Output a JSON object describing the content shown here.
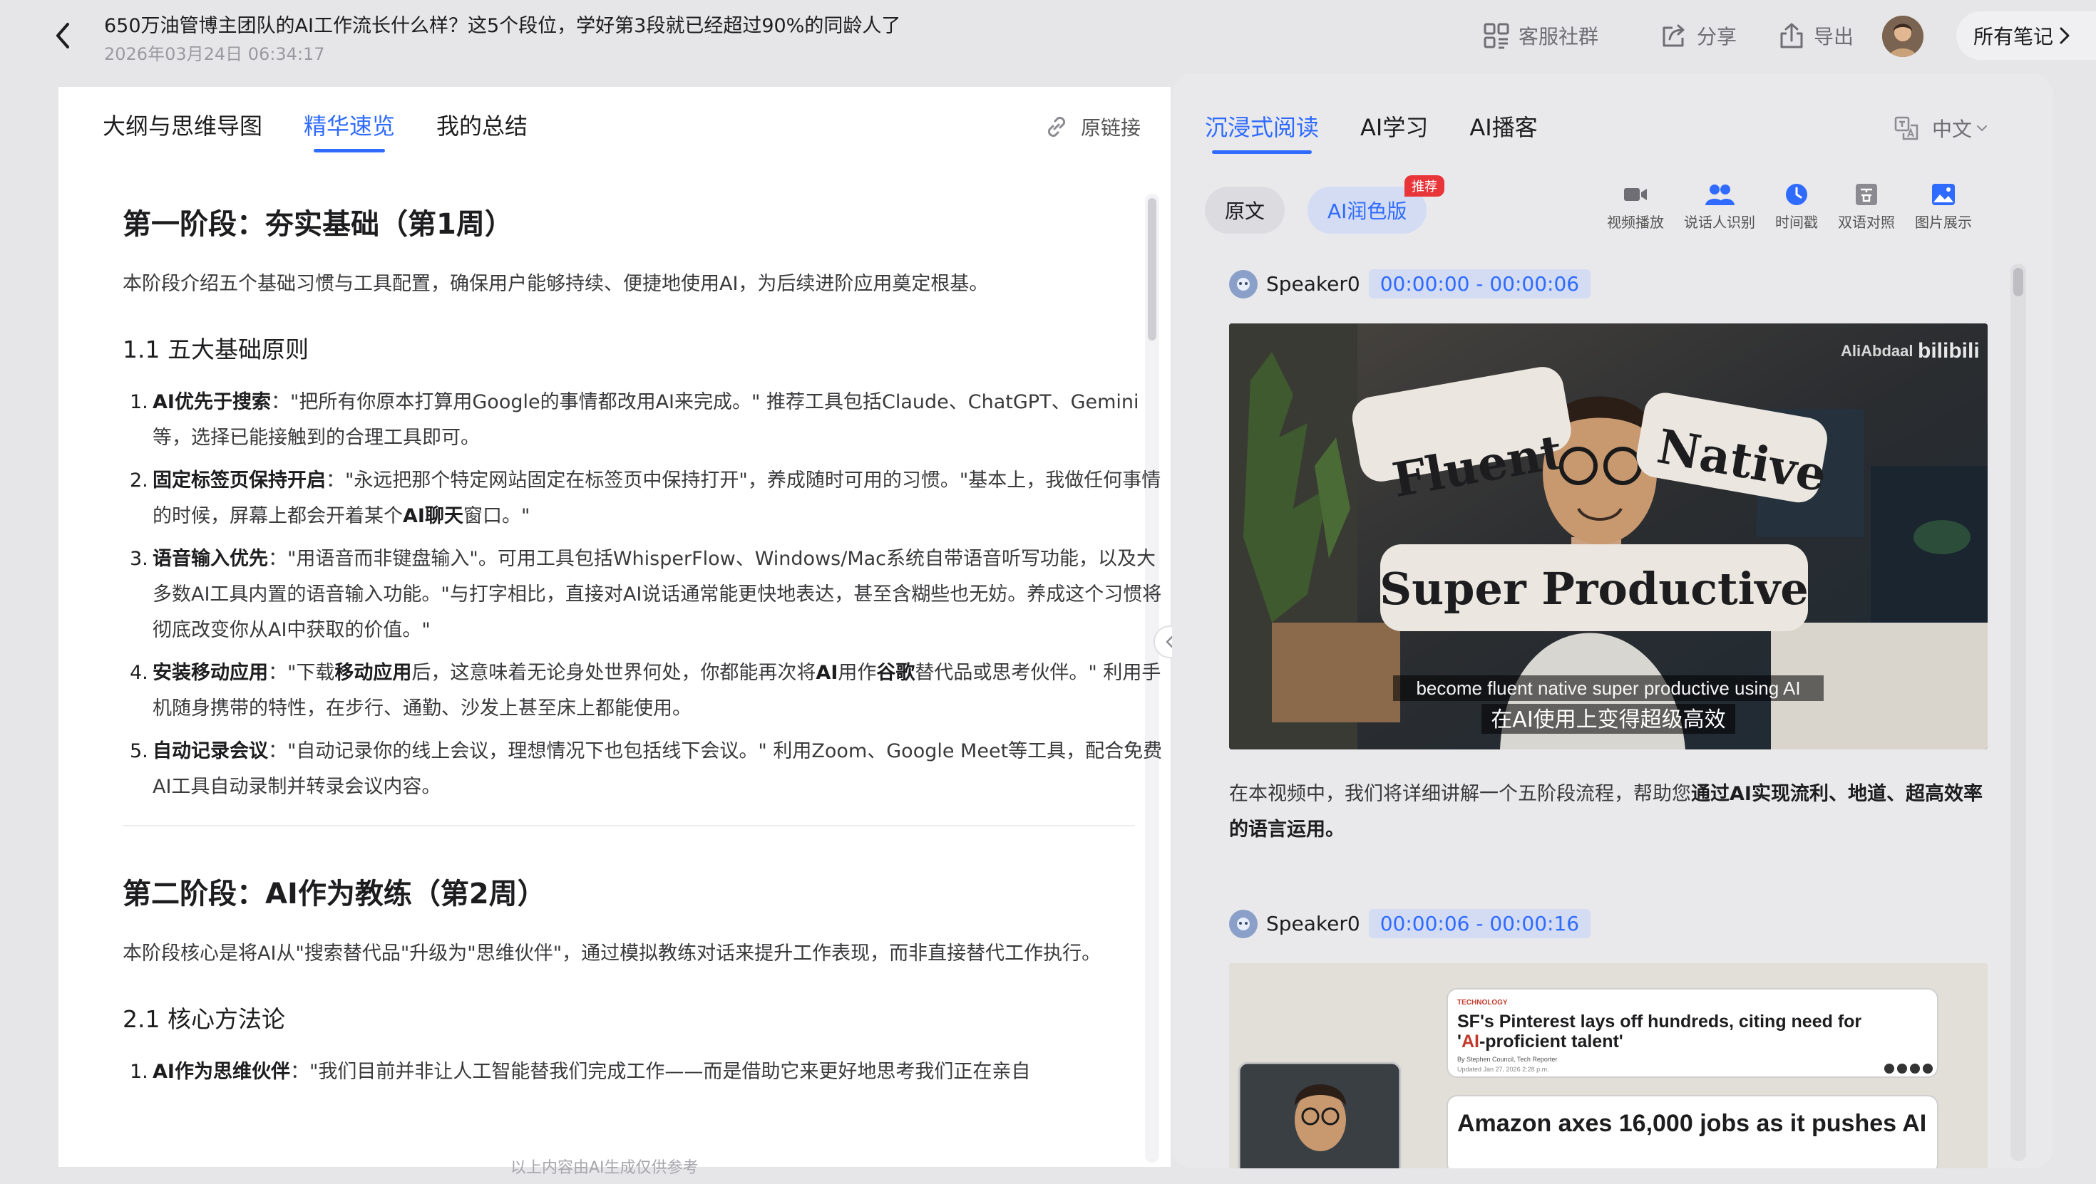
{
  "header": {
    "title": "650万油管博主团队的AI工作流长什么样？这5个段位，学好第3段就已经超过90%的同龄人了",
    "date": "2026年03月24日 06:34:17",
    "actions": {
      "community": "客服社群",
      "share": "分享",
      "export": "导出"
    },
    "all_notes": "所有笔记"
  },
  "left": {
    "tabs": [
      "大纲与思维导图",
      "精华速览",
      "我的总结"
    ],
    "active_tab": 1,
    "original_link": "原链接",
    "footnote": "以上内容由AI生成仅供参考",
    "stage1": {
      "title": "第一阶段：夯实基础（第1周）",
      "lead": "本阶段介绍五个基础习惯与工具配置，确保用户能够持续、便捷地使用AI，为后续进阶应用奠定根基。",
      "section_title": "1.1 五大基础原则",
      "items": [
        {
          "num": "1.",
          "label": "AI优先于搜索",
          "text_a": "：\"把所有你原本打算用Google的事情都改用AI来完成。\" 推荐工具包括Claude、ChatGPT、Gemini等，选择已能接触到的合理工具即可。"
        },
        {
          "num": "2.",
          "label": "固定标签页保持开启",
          "text_a": "：\"永远把那个特定网站固定在标签页中保持打开\"，养成随时可用的习惯。\"基本上，我做任何事情的时候，屏幕上都会开着某个",
          "bold_b": "AI聊天",
          "text_b": "窗口。\""
        },
        {
          "num": "3.",
          "label": "语音输入优先",
          "text_a": "：\"用语音而非键盘输入\"。可用工具包括WhisperFlow、Windows/Mac系统自带语音听写功能，以及大多数AI工具内置的语音输入功能。\"与打字相比，直接对AI说话通常能更快地表达，甚至含糊些也无妨。养成这个习惯将彻底改变你从AI中获取的价值。\""
        },
        {
          "num": "4.",
          "label": "安装移动应用",
          "text_pre": "：\"下载",
          "bold_m1": "移动应用",
          "text_m1": "后，这意味着无论身处世界何处，你都能再次将",
          "bold_m2": "AI",
          "text_m2": "用作",
          "bold_m3": "谷歌",
          "text_m3": "替代品或思考伙伴。\" 利用手机随身携带的特性，在步行、通勤、沙发上甚至床上都能使用。"
        },
        {
          "num": "5.",
          "label": "自动记录会议",
          "text_a": "：\"自动记录你的线上会议，理想情况下也包括线下会议。\" 利用Zoom、Google Meet等工具，配合免费AI工具自动录制并转录会议内容。"
        }
      ]
    },
    "stage2": {
      "title": "第二阶段：AI作为教练（第2周）",
      "lead": "本阶段核心是将AI从\"搜索替代品\"升级为\"思维伙伴\"，通过模拟教练对话来提升工作表现，而非直接替代工作执行。",
      "section_title": "2.1 核心方法论",
      "items": [
        {
          "num": "1.",
          "label": "AI作为思维伙伴",
          "text_a": "：\"我们目前并非让人工智能替我们完成工作——而是借助它来更好地思考我们正在亲自"
        }
      ]
    }
  },
  "right": {
    "tabs": [
      "沉浸式阅读",
      "AI学习",
      "AI播客"
    ],
    "active_tab": 0,
    "language": "中文",
    "mode_original": "原文",
    "mode_ai": "AI润色版",
    "recommend_badge": "推荐",
    "tools": [
      "视频播放",
      "说话人识别",
      "时间戳",
      "双语对照",
      "图片展示"
    ],
    "segments": [
      {
        "speaker": "Speaker0",
        "time": "00:00:00 - 00:00:06",
        "video": {
          "watermark": "AliAbdaal",
          "bilibili": "bilibili",
          "word1": "Fluent",
          "word2": "Native",
          "word3": "Super Productive",
          "sub_en": "become fluent native super productive using AI",
          "sub_zh": "在AI使用上变得超级高效"
        },
        "text_pre": "在本视频中，我们将详细讲解一个五阶段流程，帮助您",
        "text_bold": "通过AI实现流利、地道、超高效率的语言运用。"
      },
      {
        "speaker": "Speaker0",
        "time": "00:00:06 - 00:00:16",
        "video": {
          "tag": "TECHNOLOGY",
          "headline1": "SF's Pinterest lays off hundreds, citing need for",
          "headline2a": "'",
          "headline2b": "AI",
          "headline2c": "-proficient talent'",
          "byline": "By Stephen Council, Tech Reporter",
          "updated": "Updated Jan 27, 2026 2:28 p.m.",
          "headline3": "Amazon axes 16,000 jobs as it pushes AI"
        }
      }
    ]
  }
}
